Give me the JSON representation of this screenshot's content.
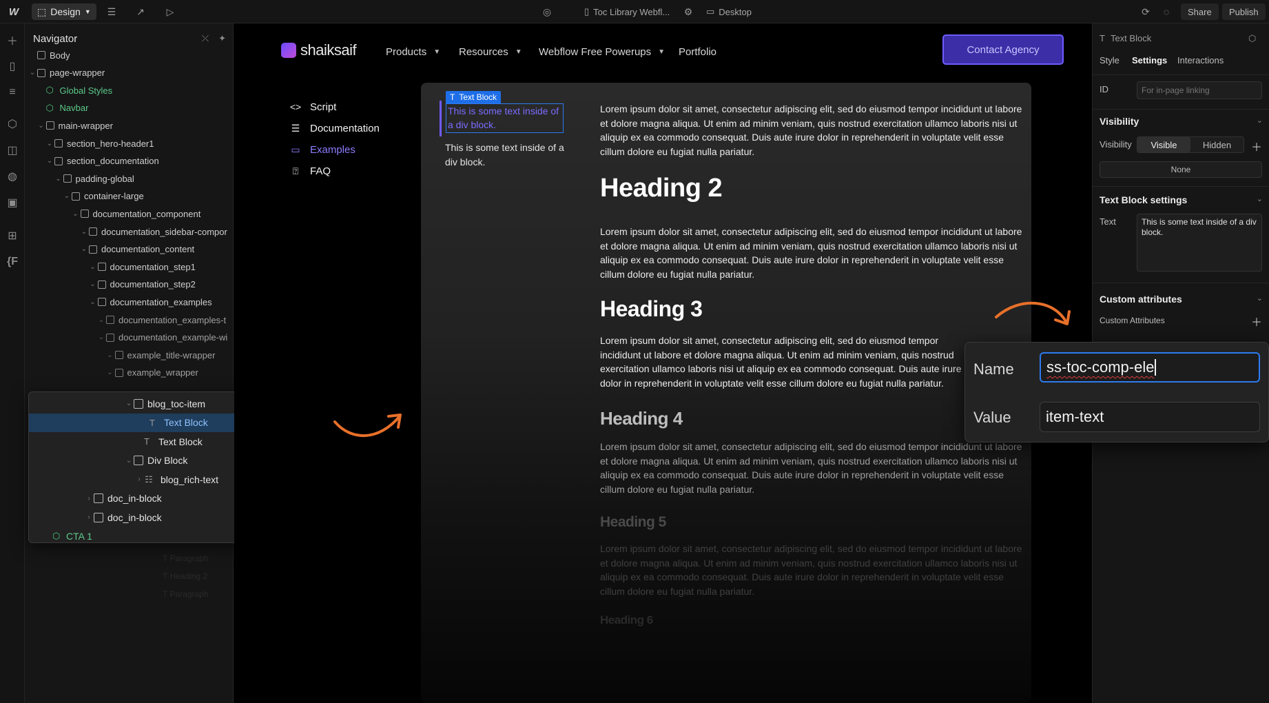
{
  "topbar": {
    "mode_label": "Design",
    "project_name": "Toc Library Webfl...",
    "breakpoint": "Desktop",
    "share_label": "Share",
    "publish_label": "Publish"
  },
  "navigator": {
    "title": "Navigator",
    "tree": [
      {
        "label": "Body",
        "depth": 0,
        "kind": "box"
      },
      {
        "label": "page-wrapper",
        "depth": 0,
        "kind": "box"
      },
      {
        "label": "Global Styles",
        "depth": 1,
        "kind": "component"
      },
      {
        "label": "Navbar",
        "depth": 1,
        "kind": "component"
      },
      {
        "label": "main-wrapper",
        "depth": 1,
        "kind": "box"
      },
      {
        "label": "section_hero-header1",
        "depth": 2,
        "kind": "box"
      },
      {
        "label": "section_documentation",
        "depth": 2,
        "kind": "box"
      },
      {
        "label": "padding-global",
        "depth": 3,
        "kind": "box"
      },
      {
        "label": "container-large",
        "depth": 4,
        "kind": "box"
      },
      {
        "label": "documentation_component",
        "depth": 5,
        "kind": "box"
      },
      {
        "label": "documentation_sidebar-compor",
        "depth": 6,
        "kind": "box"
      },
      {
        "label": "documentation_content",
        "depth": 6,
        "kind": "box"
      },
      {
        "label": "documentation_step1",
        "depth": 7,
        "kind": "box"
      },
      {
        "label": "documentation_step2",
        "depth": 7,
        "kind": "box"
      },
      {
        "label": "documentation_examples",
        "depth": 7,
        "kind": "box"
      },
      {
        "label": "documentation_examples-t",
        "depth": 8,
        "kind": "box"
      },
      {
        "label": "documentation_example-wi",
        "depth": 8,
        "kind": "box"
      },
      {
        "label": "example_title-wrapper",
        "depth": 9,
        "kind": "box"
      },
      {
        "label": "example_wrapper",
        "depth": 9,
        "kind": "box"
      }
    ],
    "popup_rows": [
      {
        "label": "blog_toc-item",
        "kind": "box",
        "selected": false
      },
      {
        "label": "Text Block",
        "kind": "text",
        "selected": true
      },
      {
        "label": "Text Block",
        "kind": "text",
        "selected": false
      },
      {
        "label": "Div Block",
        "kind": "box",
        "selected": false
      },
      {
        "label": "blog_rich-text",
        "kind": "rich",
        "selected": false
      },
      {
        "label": "doc_in-block",
        "kind": "box",
        "selected": false
      },
      {
        "label": "doc_in-block",
        "kind": "box",
        "selected": false
      },
      {
        "label": "CTA 1",
        "kind": "component",
        "selected": false
      }
    ]
  },
  "site": {
    "logo_text": "shaiksaif",
    "nav_items": [
      "Products",
      "Resources",
      "Webflow Free Powerups",
      "Portfolio"
    ],
    "contact_label": "Contact Agency",
    "sidebar_links": [
      {
        "label": "Script",
        "icon": "code-icon"
      },
      {
        "label": "Documentation",
        "icon": "lines-icon"
      },
      {
        "label": "Examples",
        "icon": "folder-icon"
      },
      {
        "label": "FAQ",
        "icon": "question-icon"
      }
    ],
    "selected_tag": "Text Block",
    "selected_text": "This is some text inside of a div block.",
    "plain_text": "This is some text inside of a div block.",
    "lorem": "Lorem ipsum dolor sit amet, consectetur adipiscing elit, sed do eiusmod tempor incididunt ut labore et dolore magna aliqua. Ut enim ad minim veniam, quis nostrud exercitation ullamco laboris nisi ut aliquip ex ea commodo consequat. Duis aute irure dolor in reprehenderit in voluptate velit esse cillum dolore eu fugiat nulla pariatur.",
    "headings": [
      "Heading 2",
      "Heading 3",
      "Heading 4",
      "Heading 5",
      "Heading 6"
    ]
  },
  "settings": {
    "element_type": "Text Block",
    "tabs": [
      "Style",
      "Settings",
      "Interactions"
    ],
    "id_label": "ID",
    "id_placeholder": "For in-page linking",
    "visibility_section": "Visibility",
    "visibility_label": "Visibility",
    "visible_option": "Visible",
    "hidden_option": "Hidden",
    "none_label": "None",
    "textblock_section": "Text Block settings",
    "text_label": "Text",
    "text_value": "This is some text inside of a div block.",
    "custom_attr_section": "Custom attributes",
    "custom_attr_label": "Custom Attributes"
  },
  "attribute_popup": {
    "name_label": "Name",
    "name_value": "ss-toc-comp-ele",
    "value_label": "Value",
    "value_value": "item-text"
  },
  "colors": {
    "accent": "#6e5cff",
    "selection_blue": "#2d7bf0",
    "annotation_arrow": "#e8702a",
    "component_green": "#5cc98a"
  }
}
